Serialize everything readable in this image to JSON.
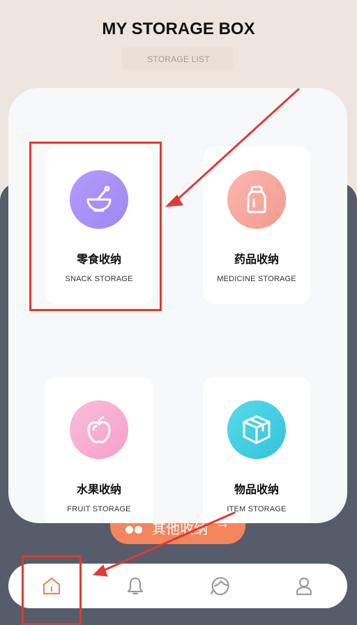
{
  "header": {
    "title": "MY STORAGE BOX",
    "subtitle": "STORAGE LIST"
  },
  "cards": [
    {
      "name_cn": "零食收纳",
      "name_en": "SNACK STORAGE",
      "icon": "bowl-icon",
      "color_from": "#b59cfb",
      "color_to": "#9c87f3"
    },
    {
      "name_cn": "药品收纳",
      "name_en": "MEDICINE STORAGE",
      "icon": "medicine-bottle-icon",
      "color_from": "#fbb7ae",
      "color_to": "#f59a8e"
    },
    {
      "name_cn": "水果收纳",
      "name_en": "FRUIT STORAGE",
      "icon": "apple-icon",
      "color_from": "#fbbddc",
      "color_to": "#f4a0c8"
    },
    {
      "name_cn": "物品收纳",
      "name_en": "ITEM STORAGE",
      "icon": "box-icon",
      "color_from": "#56dcea",
      "color_to": "#33c2dc"
    }
  ],
  "other_button": {
    "label": "其他收纳",
    "color": "#f5855c"
  },
  "tabbar": {
    "items": [
      {
        "icon": "home-icon",
        "active": true
      },
      {
        "icon": "bell-icon",
        "active": false
      },
      {
        "icon": "face-icon",
        "active": false
      },
      {
        "icon": "user-icon",
        "active": false
      }
    ],
    "active_color": "#f5855c",
    "inactive_color": "#9a9a9a"
  },
  "annotation_color": "#e03a30"
}
